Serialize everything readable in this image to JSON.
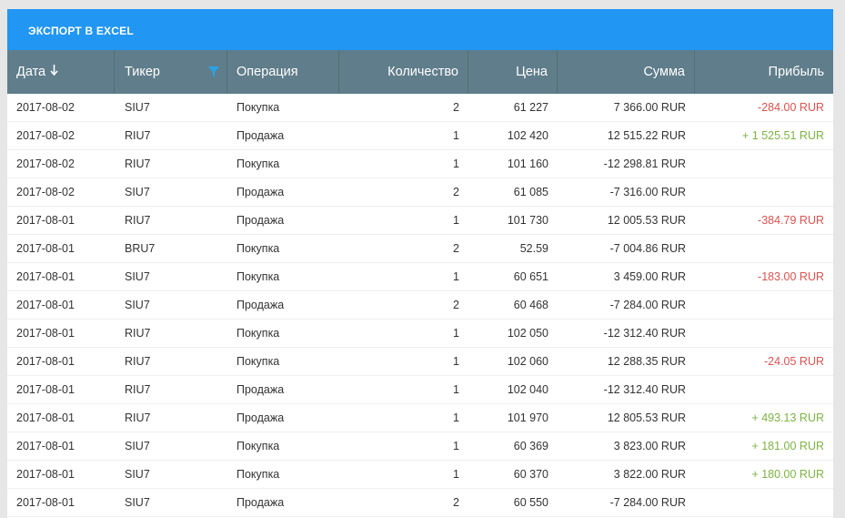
{
  "toolbar": {
    "export_label": "ЭКСПОРТ В EXCEL"
  },
  "colors": {
    "toolbar": "#2196f3",
    "header": "#607d8b",
    "loss": "#d9534f",
    "profit": "#7cb342",
    "filter_icon": "#29a3e8"
  },
  "table": {
    "headers": {
      "date": "Дата",
      "ticker": "Тикер",
      "operation": "Операция",
      "quantity": "Количество",
      "price": "Цена",
      "amount": "Сумма",
      "profit": "Прибыль"
    },
    "sort_icon": "arrow-down-icon",
    "filter_icon": "filter-icon",
    "rows": [
      {
        "date": "2017-08-02",
        "ticker": "SIU7",
        "operation": "Покупка",
        "quantity": "2",
        "price": "61 227",
        "amount": "7 366.00 RUR",
        "profit": "-284.00 RUR",
        "profit_type": "neg"
      },
      {
        "date": "2017-08-02",
        "ticker": "RIU7",
        "operation": "Продажа",
        "quantity": "1",
        "price": "102 420",
        "amount": "12 515.22 RUR",
        "profit": "+ 1 525.51 RUR",
        "profit_type": "pos"
      },
      {
        "date": "2017-08-02",
        "ticker": "RIU7",
        "operation": "Покупка",
        "quantity": "1",
        "price": "101 160",
        "amount": "-12 298.81 RUR",
        "profit": "",
        "profit_type": ""
      },
      {
        "date": "2017-08-02",
        "ticker": "SIU7",
        "operation": "Продажа",
        "quantity": "2",
        "price": "61 085",
        "amount": "-7 316.00 RUR",
        "profit": "",
        "profit_type": ""
      },
      {
        "date": "2017-08-01",
        "ticker": "RIU7",
        "operation": "Продажа",
        "quantity": "1",
        "price": "101 730",
        "amount": "12 005.53 RUR",
        "profit": "-384.79 RUR",
        "profit_type": "neg"
      },
      {
        "date": "2017-08-01",
        "ticker": "BRU7",
        "operation": "Покупка",
        "quantity": "2",
        "price": "52.59",
        "amount": "-7 004.86 RUR",
        "profit": "",
        "profit_type": ""
      },
      {
        "date": "2017-08-01",
        "ticker": "SIU7",
        "operation": "Покупка",
        "quantity": "1",
        "price": "60 651",
        "amount": "3 459.00 RUR",
        "profit": "-183.00 RUR",
        "profit_type": "neg"
      },
      {
        "date": "2017-08-01",
        "ticker": "SIU7",
        "operation": "Продажа",
        "quantity": "2",
        "price": "60 468",
        "amount": "-7 284.00 RUR",
        "profit": "",
        "profit_type": ""
      },
      {
        "date": "2017-08-01",
        "ticker": "RIU7",
        "operation": "Покупка",
        "quantity": "1",
        "price": "102 050",
        "amount": "-12 312.40 RUR",
        "profit": "",
        "profit_type": ""
      },
      {
        "date": "2017-08-01",
        "ticker": "RIU7",
        "operation": "Покупка",
        "quantity": "1",
        "price": "102 060",
        "amount": "12 288.35 RUR",
        "profit": "-24.05 RUR",
        "profit_type": "neg"
      },
      {
        "date": "2017-08-01",
        "ticker": "RIU7",
        "operation": "Продажа",
        "quantity": "1",
        "price": "102 040",
        "amount": "-12 312.40 RUR",
        "profit": "",
        "profit_type": ""
      },
      {
        "date": "2017-08-01",
        "ticker": "RIU7",
        "operation": "Продажа",
        "quantity": "1",
        "price": "101 970",
        "amount": "12 805.53 RUR",
        "profit": "+ 493.13 RUR",
        "profit_type": "pos"
      },
      {
        "date": "2017-08-01",
        "ticker": "SIU7",
        "operation": "Покупка",
        "quantity": "1",
        "price": "60 369",
        "amount": "3 823.00 RUR",
        "profit": "+ 181.00 RUR",
        "profit_type": "pos"
      },
      {
        "date": "2017-08-01",
        "ticker": "SIU7",
        "operation": "Покупка",
        "quantity": "1",
        "price": "60 370",
        "amount": "3 822.00 RUR",
        "profit": "+ 180.00 RUR",
        "profit_type": "pos"
      },
      {
        "date": "2017-08-01",
        "ticker": "SIU7",
        "operation": "Продажа",
        "quantity": "2",
        "price": "60 550",
        "amount": "-7 284.00 RUR",
        "profit": "",
        "profit_type": ""
      }
    ]
  }
}
